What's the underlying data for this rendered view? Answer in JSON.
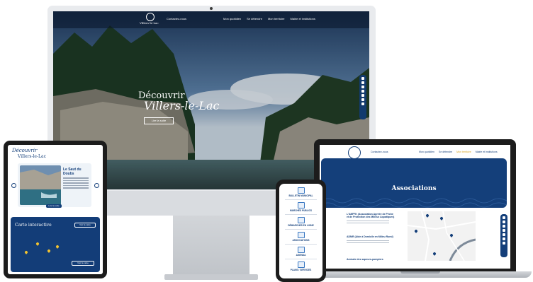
{
  "desktop": {
    "logo_text": "Villers-le-Lac",
    "contact": "Contactez-nous",
    "menu": [
      "Mon quotidien",
      "Se détendre",
      "Mon territoire",
      "Mairie et institutions"
    ],
    "hero_title": "Découvrir",
    "hero_script": "Villers-le-Lac",
    "hero_button": "Lire la suite"
  },
  "tablet": {
    "title": "Découvrir",
    "subtitle": "Villers-le-Lac",
    "card_title": "Le Saut du Doubs",
    "card_button": "Lire la suite",
    "map_title": "Carte interactive",
    "map_button": "Voir la carte",
    "map_button2": "Voir la carte"
  },
  "laptop": {
    "logo_text": "Villers-le-Lac",
    "contact": "Contactez-nous",
    "menu": [
      "Mon quotidien",
      "Se détendre",
      "Mon territoire",
      "Mairie et institutions"
    ],
    "hero_title": "Associations",
    "entries": [
      "L'ABFFK (Association Agréée de Pêche et de Protection des Milieux Aquatiques)",
      "ADMR (Aide à Domicile en Milieu Rural)",
      "Amicale des sapeurs-pompiers"
    ]
  },
  "phone": {
    "items": [
      "BULLETIN MUNICIPAL",
      "MARCHÉS PUBLICS",
      "DÉMARCHES EN LIGNE",
      "ASSOCIATIONS",
      "AGENDA",
      "PLANS / SERVICES"
    ]
  },
  "colors": {
    "brand_blue": "#143f7a",
    "accent_yellow": "#f2c230",
    "device_dark": "#1c1c1c"
  }
}
